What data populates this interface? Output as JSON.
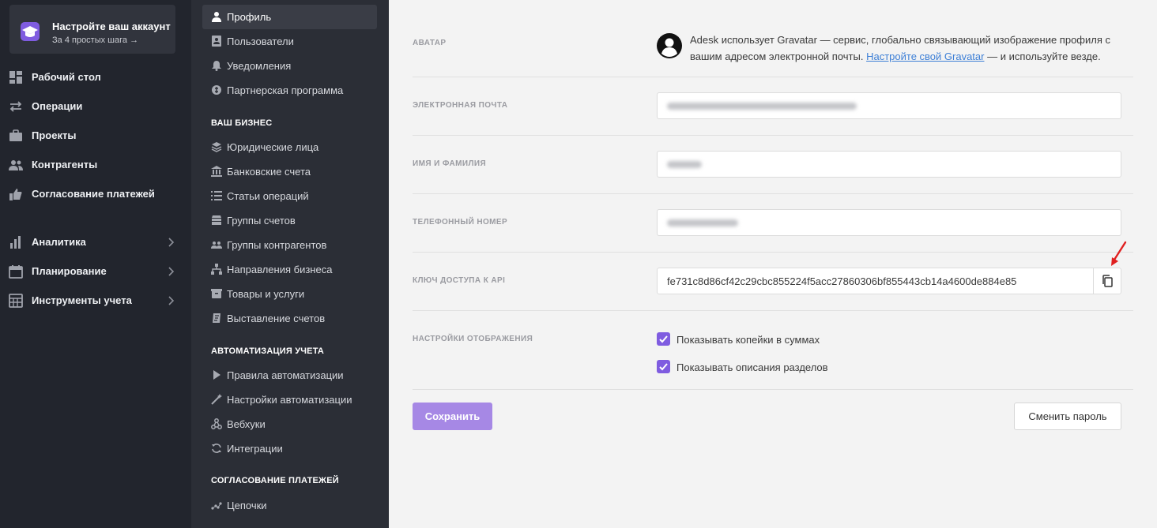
{
  "setup": {
    "title": "Настройте ваш аккаунт",
    "subtitle": "За 4 простых шага →",
    "icon": "graduation-cap-icon"
  },
  "primary_nav": [
    {
      "label": "Рабочий стол",
      "icon": "dashboard-icon"
    },
    {
      "label": "Операции",
      "icon": "transfer-icon"
    },
    {
      "label": "Проекты",
      "icon": "briefcase-icon"
    },
    {
      "label": "Контрагенты",
      "icon": "users-icon"
    },
    {
      "label": "Согласование платежей",
      "icon": "thumbs-up-icon"
    },
    {
      "label": "Аналитика",
      "icon": "bar-chart-icon"
    },
    {
      "label": "Планирование",
      "icon": "calendar-icon"
    },
    {
      "label": "Инструменты учета",
      "icon": "calculator-icon"
    }
  ],
  "secondary_nav": {
    "top_items": [
      {
        "label": "Профиль",
        "icon": "person-icon",
        "active": true
      },
      {
        "label": "Пользователи",
        "icon": "address-book-icon"
      },
      {
        "label": "Уведомления",
        "icon": "bell-icon"
      },
      {
        "label": "Партнерская программа",
        "icon": "coin-icon"
      }
    ],
    "sections": [
      {
        "title": "ВАШ БИЗНЕС",
        "items": [
          {
            "label": "Юридические лица",
            "icon": "layers-icon"
          },
          {
            "label": "Банковские счета",
            "icon": "bank-icon"
          },
          {
            "label": "Статьи операций",
            "icon": "list-icon"
          },
          {
            "label": "Группы счетов",
            "icon": "stack-icon"
          },
          {
            "label": "Группы контрагентов",
            "icon": "user-group-icon"
          },
          {
            "label": "Направления бизнеса",
            "icon": "sitemap-icon"
          },
          {
            "label": "Товары и услуги",
            "icon": "box-icon"
          },
          {
            "label": "Выставление счетов",
            "icon": "invoice-icon"
          }
        ]
      },
      {
        "title": "АВТОМАТИЗАЦИЯ УЧЕТА",
        "items": [
          {
            "label": "Правила автоматизации",
            "icon": "play-icon"
          },
          {
            "label": "Настройки автоматизации",
            "icon": "magic-wand-icon"
          },
          {
            "label": "Вебхуки",
            "icon": "webhook-icon"
          },
          {
            "label": "Интеграции",
            "icon": "sync-icon"
          }
        ]
      },
      {
        "title": "СОГЛАСОВАНИЕ ПЛАТЕЖЕЙ",
        "items": [
          {
            "label": "Цепочки",
            "icon": "chain-icon"
          }
        ]
      }
    ]
  },
  "profile": {
    "avatar": {
      "label": "АВАТАР",
      "text_before": "Adesk использует Gravatar — сервис, глобально связывающий изображение профиля с вашим адресом электронной почты. ",
      "link_text": "Настройте свой Gravatar",
      "text_after": " — и используйте везде."
    },
    "email": {
      "label": "ЭЛЕКТРОННАЯ ПОЧТА",
      "value": ""
    },
    "name": {
      "label": "ИМЯ И ФАМИЛИЯ",
      "value": ""
    },
    "phone": {
      "label": "ТЕЛЕФОННЫЙ НОМЕР",
      "value": ""
    },
    "api_key": {
      "label": "КЛЮЧ ДОСТУПА К API",
      "value": "fe731c8d86cf42c29cbc855224f5acc27860306bf855443cb14a4600de884e85"
    },
    "display": {
      "label": "НАСТРОЙКИ ОТОБРАЖЕНИЯ",
      "options": [
        {
          "label": "Показывать копейки в суммах",
          "checked": true
        },
        {
          "label": "Показывать описания разделов",
          "checked": true
        }
      ]
    },
    "save_label": "Сохранить",
    "change_password_label": "Сменить пароль"
  },
  "colors": {
    "accent": "#7f5ce0",
    "link": "#3d7fd6",
    "annotation_arrow": "#e02020"
  }
}
